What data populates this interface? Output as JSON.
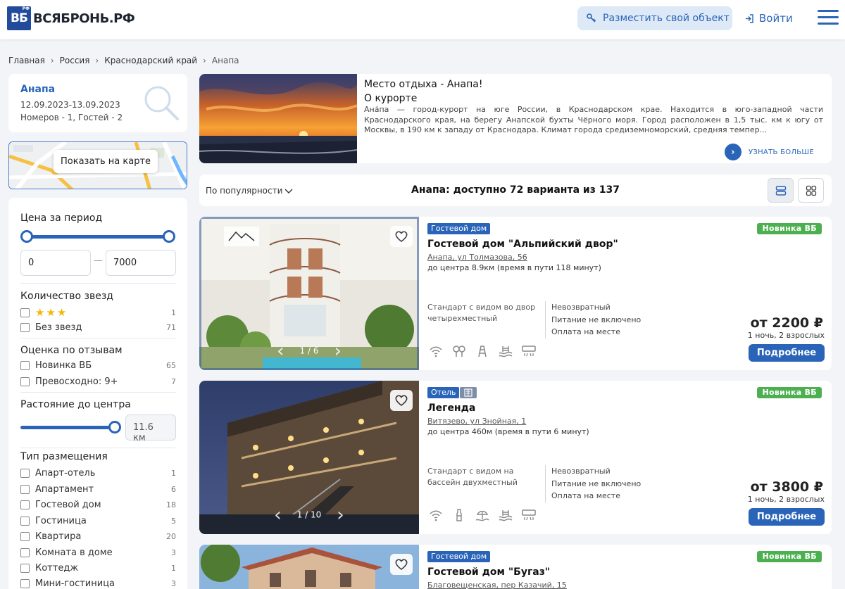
{
  "header": {
    "logo_mark": "ВБ",
    "logo_rf": "РФ",
    "logo_text": "ВСЯБРОНЬ.РФ",
    "place_button": "Разместить свой объект",
    "login_button": "Войти"
  },
  "breadcrumb": [
    "Главная",
    "Россия",
    "Краснодарский край",
    "Анапа"
  ],
  "search": {
    "city": "Анапа",
    "dates": "12.09.2023-13.09.2023",
    "guests": "Номеров - 1, Гостей - 2"
  },
  "map": {
    "label": "Показать на карте"
  },
  "filters": {
    "price": {
      "title": "Цена за период",
      "min": "0",
      "max": "7000",
      "dash": "—"
    },
    "stars": {
      "title": "Количество звезд",
      "items": [
        {
          "label": "★★★",
          "count": "1"
        },
        {
          "label": "Без звезд",
          "count": "71"
        }
      ]
    },
    "rating": {
      "title": "Оценка по отзывам",
      "items": [
        {
          "label": "Новинка ВБ",
          "count": "65"
        },
        {
          "label": "Превосходно: 9+",
          "count": "7"
        }
      ]
    },
    "distance": {
      "title": "Растояние до центра",
      "value": "11.6 км",
      "level": 1.0
    },
    "type": {
      "title": "Тип размещения",
      "items": [
        {
          "label": "Апарт-отель",
          "count": "1"
        },
        {
          "label": "Апартамент",
          "count": "6"
        },
        {
          "label": "Гостевой дом",
          "count": "18"
        },
        {
          "label": "Гостиница",
          "count": "5"
        },
        {
          "label": "Квартира",
          "count": "20"
        },
        {
          "label": "Комната в доме",
          "count": "3"
        },
        {
          "label": "Коттедж",
          "count": "1"
        },
        {
          "label": "Мини-гостиница",
          "count": "3"
        }
      ]
    }
  },
  "info": {
    "title": "Место отдыха - Анапа!",
    "subtitle": "О курорте",
    "text": "Ана́па — город-курорт на юге России, в Краснодарском крае. Находится в юго-западной части Краснодарского края, на берегу Анапской бухты Чёрного моря. Город расположен в 1,5 тыс. км к югу от Москвы, в 190 км к западу от Краснодара. Климат города средиземноморский, средняя темпер...",
    "more": "УЗНАТЬ БОЛЬШЕ"
  },
  "sort": {
    "label": "По популярности",
    "summary": "Анапа: доступно 72 варианта из 137"
  },
  "listings": [
    {
      "tags": [
        "Гостевой дом"
      ],
      "badge": "Новинка ВБ",
      "name": "Гостевой дом \"Альпийский двор\"",
      "address": "Анапа, ул Толмазова, 56",
      "dist_label": "до центра",
      "dist_value": "8.9км (время в пути 118 минут)",
      "room": "Стандарт с видом во двор четырехместный",
      "conds": [
        "Невозвратный",
        "Питание не включено",
        "Оплата на месте"
      ],
      "price": "от 2200 ₽",
      "nights": "1 ночь, 2 взрослых",
      "button": "Подробнее",
      "pager": "1 / 6",
      "amenities": [
        "wifi-icon",
        "playground-icon",
        "pool-ladder-icon",
        "pool-icon",
        "ac-icon"
      ]
    },
    {
      "tags": [
        "Отель"
      ],
      "badge": "Новинка ВБ",
      "name": "Легенда",
      "address": "Витязево, ул Знойная, 1",
      "dist_label": "до центра",
      "dist_value": "460м (время в пути 6 минут)",
      "room": "Стандарт с видом на бассейн двухместный",
      "conds": [
        "Невозвратный",
        "Питание не включено",
        "Оплата на месте"
      ],
      "price": "от 3800 ₽",
      "nights": "1 ночь, 2 взрослых",
      "button": "Подробнее",
      "pager": "1 / 10",
      "amenities": [
        "wifi-icon",
        "bottle-icon",
        "beach-icon",
        "pool-icon",
        "ac-icon"
      ]
    },
    {
      "tags": [
        "Гостевой дом"
      ],
      "badge": "Новинка ВБ",
      "name": "Гостевой дом \"Бугаз\"",
      "address": "Благовещенская, пер Казачий, 15"
    }
  ],
  "colors": {
    "accent": "#2a64b8",
    "new_badge": "#4caf50",
    "brand": "#234b9b",
    "star": "#f2b705"
  }
}
